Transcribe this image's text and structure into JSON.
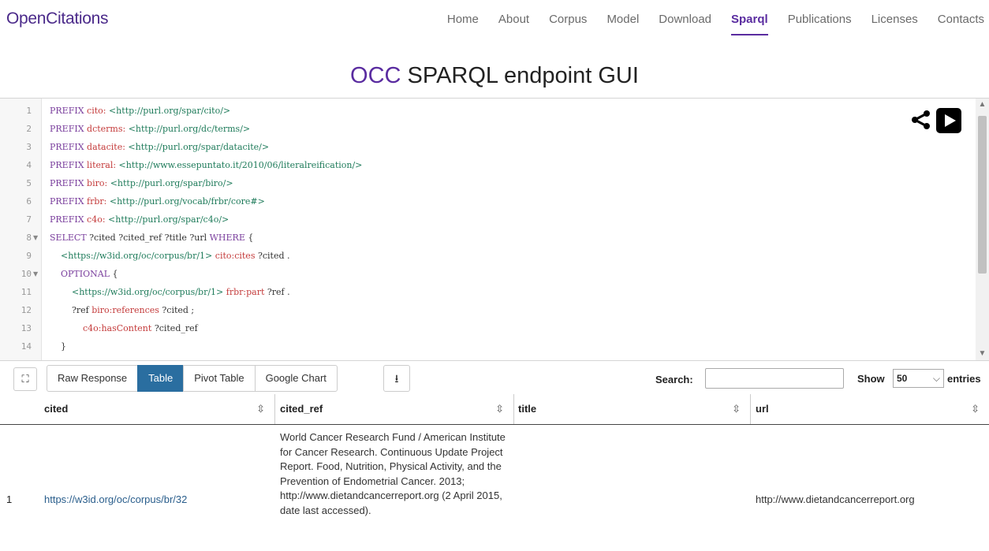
{
  "brand": "OpenCitations",
  "nav": [
    "Home",
    "About",
    "Corpus",
    "Model",
    "Download",
    "Sparql",
    "Publications",
    "Licenses",
    "Contacts"
  ],
  "nav_active": "Sparql",
  "title": {
    "accent": "OCC",
    "rest": " SPARQL endpoint GUI"
  },
  "code_lines": [
    {
      "n": "1",
      "fold": false,
      "parts": [
        [
          "kw",
          "PREFIX "
        ],
        [
          "pfx",
          "cito: "
        ],
        [
          "uri",
          "<http://purl.org/spar/cito/>"
        ]
      ]
    },
    {
      "n": "2",
      "fold": false,
      "parts": [
        [
          "kw",
          "PREFIX "
        ],
        [
          "pfx",
          "dcterms: "
        ],
        [
          "uri",
          "<http://purl.org/dc/terms/>"
        ]
      ]
    },
    {
      "n": "3",
      "fold": false,
      "parts": [
        [
          "kw",
          "PREFIX "
        ],
        [
          "pfx",
          "datacite: "
        ],
        [
          "uri",
          "<http://purl.org/spar/datacite/>"
        ]
      ]
    },
    {
      "n": "4",
      "fold": false,
      "parts": [
        [
          "kw",
          "PREFIX "
        ],
        [
          "pfx",
          "literal: "
        ],
        [
          "uri",
          "<http://www.essepuntato.it/2010/06/literalreification/>"
        ]
      ]
    },
    {
      "n": "5",
      "fold": false,
      "parts": [
        [
          "kw",
          "PREFIX "
        ],
        [
          "pfx",
          "biro: "
        ],
        [
          "uri",
          "<http://purl.org/spar/biro/>"
        ]
      ]
    },
    {
      "n": "6",
      "fold": false,
      "parts": [
        [
          "kw",
          "PREFIX "
        ],
        [
          "pfx",
          "frbr: "
        ],
        [
          "uri",
          "<http://purl.org/vocab/frbr/core#>"
        ]
      ]
    },
    {
      "n": "7",
      "fold": false,
      "parts": [
        [
          "kw",
          "PREFIX "
        ],
        [
          "pfx",
          "c4o: "
        ],
        [
          "uri",
          "<http://purl.org/spar/c4o/>"
        ]
      ]
    },
    {
      "n": "8",
      "fold": true,
      "parts": [
        [
          "kw",
          "SELECT "
        ],
        [
          "var",
          "?cited ?cited_ref ?title ?url "
        ],
        [
          "kw",
          "WHERE "
        ],
        [
          "var",
          "{"
        ]
      ]
    },
    {
      "n": "9",
      "fold": false,
      "parts": [
        [
          "var",
          "    "
        ],
        [
          "uri",
          "<https://w3id.org/oc/corpus/br/1> "
        ],
        [
          "pfx",
          "cito:cites "
        ],
        [
          "var",
          "?cited ."
        ]
      ]
    },
    {
      "n": "10",
      "fold": true,
      "parts": [
        [
          "var",
          "    "
        ],
        [
          "kw",
          "OPTIONAL "
        ],
        [
          "var",
          "{"
        ]
      ]
    },
    {
      "n": "11",
      "fold": false,
      "parts": [
        [
          "var",
          "        "
        ],
        [
          "uri",
          "<https://w3id.org/oc/corpus/br/1> "
        ],
        [
          "pfx",
          "frbr:part "
        ],
        [
          "var",
          "?ref ."
        ]
      ]
    },
    {
      "n": "12",
      "fold": false,
      "parts": [
        [
          "var",
          "        ?ref "
        ],
        [
          "pfx",
          "biro:references "
        ],
        [
          "var",
          "?cited ;"
        ]
      ]
    },
    {
      "n": "13",
      "fold": false,
      "parts": [
        [
          "var",
          "            "
        ],
        [
          "pfx",
          "c4o:hasContent "
        ],
        [
          "var",
          "?cited_ref"
        ]
      ]
    },
    {
      "n": "14",
      "fold": false,
      "parts": [
        [
          "var",
          "    }"
        ]
      ]
    }
  ],
  "toolbar": {
    "buttons": [
      "Raw Response",
      "Table",
      "Pivot Table",
      "Google Chart"
    ],
    "active": "Table",
    "search_label": "Search:",
    "search_value": "",
    "show_label": "Show",
    "show_value": "50",
    "entries_label": "entries"
  },
  "table": {
    "columns": [
      "cited",
      "cited_ref",
      "title",
      "url"
    ],
    "rows": [
      {
        "index": "1",
        "cited": "https://w3id.org/oc/corpus/br/32",
        "cited_ref": "World Cancer Research Fund / American Institute for Cancer Research. Continuous Update Project Report. Food, Nutrition, Physical Activity, and the Prevention of Endometrial Cancer. 2013; http://www.dietandcancerreport.org (2 April 2015, date last accessed).",
        "title": "",
        "url": "http://www.dietandcancerreport.org"
      }
    ]
  }
}
